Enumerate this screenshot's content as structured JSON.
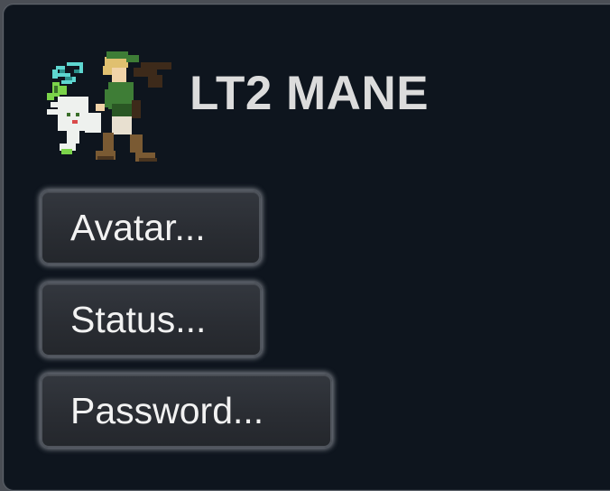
{
  "user": {
    "name": "LT2 MANE",
    "avatar_icon": "pixel-character-sprite-icon"
  },
  "menu": {
    "avatar_label": "Avatar...",
    "status_label": "Status...",
    "password_label": "Password..."
  },
  "colors": {
    "panel_background": "#0e151e",
    "text": "#dcdcdc",
    "button_background": "#2c2f35",
    "button_glow": "#d2d4da"
  }
}
